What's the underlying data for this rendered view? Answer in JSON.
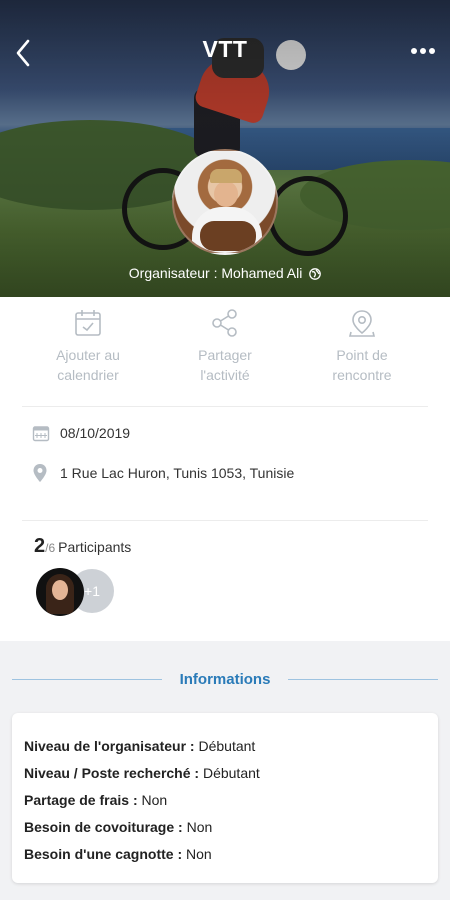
{
  "header": {
    "title": "VTT",
    "back_icon": "chevron-left-icon",
    "more_icon": "more-horizontal-icon"
  },
  "organizer": {
    "label": "Organisateur : Mohamed Ali",
    "badge_icon": "globe-icon"
  },
  "actions": [
    {
      "label": "Ajouter au\ncalendrier",
      "icon": "calendar-check-icon"
    },
    {
      "label": "Partager\nl'activité",
      "icon": "share-icon"
    },
    {
      "label": "Point de\nrencontre",
      "icon": "map-pin-icon"
    }
  ],
  "details": {
    "date": "08/10/2019",
    "date_icon": "calendar-icon",
    "address": "1 Rue Lac Huron, Tunis 1053, Tunisie",
    "address_icon": "location-pin-icon"
  },
  "participants": {
    "current": "2",
    "total": "/6",
    "label": "Participants",
    "more": "+1"
  },
  "info": {
    "title": "Informations",
    "lines": [
      {
        "key": "Niveau de l'organisateur :",
        "value": " Débutant"
      },
      {
        "key": "Niveau / Poste recherché :",
        "value": " Débutant"
      },
      {
        "key": "Partage de frais :",
        "value": " Non"
      },
      {
        "key": "Besoin de covoiturage :",
        "value": " Non"
      },
      {
        "key": "Besoin d'une cagnotte :",
        "value": " Non"
      }
    ]
  },
  "colors": {
    "accent": "#2a7bb8",
    "muted_icon": "#b5bcc3",
    "section_bg": "#f1f2f4"
  }
}
